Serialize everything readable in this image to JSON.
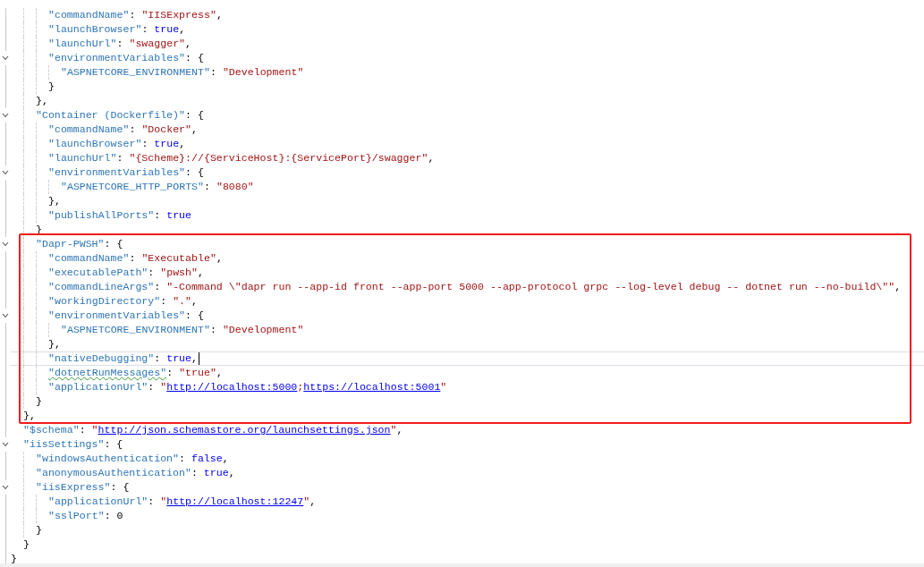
{
  "editor": {
    "root": {
      "children": [
        {
          "children": [
            {
              "children": [
                {
                  "line": [
                    {
                      "kind": "key",
                      "text": "\"commandName\""
                    },
                    {
                      "kind": "p",
                      "text": ": "
                    },
                    {
                      "kind": "str",
                      "text": "\"IISExpress\""
                    },
                    {
                      "kind": "p",
                      "text": ","
                    }
                  ]
                },
                {
                  "line": [
                    {
                      "kind": "key",
                      "text": "\"launchBrowser\""
                    },
                    {
                      "kind": "p",
                      "text": ": "
                    },
                    {
                      "kind": "kw",
                      "text": "true"
                    },
                    {
                      "kind": "p",
                      "text": ","
                    }
                  ]
                },
                {
                  "line": [
                    {
                      "kind": "key",
                      "text": "\"launchUrl\""
                    },
                    {
                      "kind": "p",
                      "text": ": "
                    },
                    {
                      "kind": "str",
                      "text": "\"swagger\""
                    },
                    {
                      "kind": "p",
                      "text": ","
                    }
                  ]
                },
                {
                  "line": [
                    {
                      "kind": "key",
                      "text": "\"environmentVariables\""
                    },
                    {
                      "kind": "p",
                      "text": ": {"
                    }
                  ],
                  "children": [
                    {
                      "line": [
                        {
                          "kind": "key",
                          "text": "\"ASPNETCORE_ENVIRONMENT\""
                        },
                        {
                          "kind": "p",
                          "text": ": "
                        },
                        {
                          "kind": "str",
                          "text": "\"Development\""
                        }
                      ]
                    }
                  ],
                  "close": [
                    {
                      "kind": "p",
                      "text": "}"
                    }
                  ]
                }
              ],
              "close": [
                {
                  "kind": "p",
                  "text": "},"
                }
              ]
            },
            {
              "line": [
                {
                  "kind": "key",
                  "text": "\"Container (Dockerfile)\""
                },
                {
                  "kind": "p",
                  "text": ": {"
                }
              ],
              "children": [
                {
                  "line": [
                    {
                      "kind": "key",
                      "text": "\"commandName\""
                    },
                    {
                      "kind": "p",
                      "text": ": "
                    },
                    {
                      "kind": "str",
                      "text": "\"Docker\""
                    },
                    {
                      "kind": "p",
                      "text": ","
                    }
                  ]
                },
                {
                  "line": [
                    {
                      "kind": "key",
                      "text": "\"launchBrowser\""
                    },
                    {
                      "kind": "p",
                      "text": ": "
                    },
                    {
                      "kind": "kw",
                      "text": "true"
                    },
                    {
                      "kind": "p",
                      "text": ","
                    }
                  ]
                },
                {
                  "line": [
                    {
                      "kind": "key",
                      "text": "\"launchUrl\""
                    },
                    {
                      "kind": "p",
                      "text": ": "
                    },
                    {
                      "kind": "str",
                      "text": "\"{Scheme}://{ServiceHost}:{ServicePort}/swagger\""
                    },
                    {
                      "kind": "p",
                      "text": ","
                    }
                  ]
                },
                {
                  "line": [
                    {
                      "kind": "key",
                      "text": "\"environmentVariables\""
                    },
                    {
                      "kind": "p",
                      "text": ": {"
                    }
                  ],
                  "children": [
                    {
                      "line": [
                        {
                          "kind": "key",
                          "text": "\"ASPNETCORE_HTTP_PORTS\""
                        },
                        {
                          "kind": "p",
                          "text": ": "
                        },
                        {
                          "kind": "str",
                          "text": "\"8080\""
                        }
                      ]
                    }
                  ],
                  "close": [
                    {
                      "kind": "p",
                      "text": "},"
                    }
                  ]
                },
                {
                  "line": [
                    {
                      "kind": "key",
                      "text": "\"publishAllPorts\""
                    },
                    {
                      "kind": "p",
                      "text": ": "
                    },
                    {
                      "kind": "kw",
                      "text": "true"
                    }
                  ]
                }
              ],
              "close": [
                {
                  "kind": "p",
                  "text": "}"
                }
              ]
            },
            {
              "boxed": true,
              "line": [
                {
                  "kind": "key",
                  "text": "\"Dapr-PWSH\""
                },
                {
                  "kind": "p",
                  "text": ": {"
                }
              ],
              "children": [
                {
                  "line": [
                    {
                      "kind": "key",
                      "text": "\"commandName\""
                    },
                    {
                      "kind": "p",
                      "text": ": "
                    },
                    {
                      "kind": "str",
                      "text": "\"Executable\""
                    },
                    {
                      "kind": "p",
                      "text": ","
                    }
                  ]
                },
                {
                  "line": [
                    {
                      "kind": "key",
                      "text": "\"executablePath\""
                    },
                    {
                      "kind": "p",
                      "text": ": "
                    },
                    {
                      "kind": "str",
                      "text": "\"pwsh\""
                    },
                    {
                      "kind": "p",
                      "text": ","
                    }
                  ]
                },
                {
                  "line": [
                    {
                      "kind": "key",
                      "text": "\"commandLineArgs\""
                    },
                    {
                      "kind": "p",
                      "text": ": "
                    },
                    {
                      "kind": "str",
                      "text": "\"-Command \\\"dapr run --app-id front --app-port 5000 --app-protocol grpc --log-level debug -- dotnet run --no-build\\\"\""
                    },
                    {
                      "kind": "p",
                      "text": ","
                    }
                  ]
                },
                {
                  "line": [
                    {
                      "kind": "key",
                      "text": "\"workingDirectory\""
                    },
                    {
                      "kind": "p",
                      "text": ": "
                    },
                    {
                      "kind": "str",
                      "text": "\".\""
                    },
                    {
                      "kind": "p",
                      "text": ","
                    }
                  ]
                },
                {
                  "line": [
                    {
                      "kind": "key",
                      "text": "\"environmentVariables\""
                    },
                    {
                      "kind": "p",
                      "text": ": {"
                    }
                  ],
                  "children": [
                    {
                      "line": [
                        {
                          "kind": "key",
                          "text": "\"ASPNETCORE_ENVIRONMENT\""
                        },
                        {
                          "kind": "p",
                          "text": ": "
                        },
                        {
                          "kind": "str",
                          "text": "\"Development\""
                        }
                      ]
                    }
                  ],
                  "close": [
                    {
                      "kind": "p",
                      "text": "},"
                    }
                  ]
                },
                {
                  "current": true,
                  "line": [
                    {
                      "kind": "key",
                      "text": "\"nativeDebugging\""
                    },
                    {
                      "kind": "p",
                      "text": ": "
                    },
                    {
                      "kind": "kw",
                      "text": "true"
                    },
                    {
                      "kind": "p",
                      "text": ","
                    }
                  ]
                },
                {
                  "line": [
                    {
                      "kind": "key-warning",
                      "text": "\"dotnetRunMessages\""
                    },
                    {
                      "kind": "p",
                      "text": ": "
                    },
                    {
                      "kind": "str",
                      "text": "\"true\""
                    },
                    {
                      "kind": "p",
                      "text": ","
                    }
                  ]
                },
                {
                  "line": [
                    {
                      "kind": "key",
                      "text": "\"applicationUrl\""
                    },
                    {
                      "kind": "p",
                      "text": ": "
                    },
                    {
                      "kind": "str",
                      "text": "\""
                    },
                    {
                      "kind": "link",
                      "text": "http://localhost:5000"
                    },
                    {
                      "kind": "str",
                      "text": ";"
                    },
                    {
                      "kind": "link",
                      "text": "https://localhost:5001"
                    },
                    {
                      "kind": "str",
                      "text": "\""
                    }
                  ]
                }
              ],
              "close": [
                {
                  "kind": "p",
                  "text": "}"
                }
              ]
            }
          ],
          "close": [
            {
              "kind": "p",
              "text": "},"
            }
          ]
        },
        {
          "line": [
            {
              "kind": "key",
              "text": "\"$schema\""
            },
            {
              "kind": "p",
              "text": ": "
            },
            {
              "kind": "str",
              "text": "\""
            },
            {
              "kind": "link",
              "text": "http://json.schemastore.org/launchsettings.json"
            },
            {
              "kind": "str",
              "text": "\""
            },
            {
              "kind": "p",
              "text": ","
            }
          ]
        },
        {
          "line": [
            {
              "kind": "key",
              "text": "\"iisSettings\""
            },
            {
              "kind": "p",
              "text": ": {"
            }
          ],
          "children": [
            {
              "line": [
                {
                  "kind": "key",
                  "text": "\"windowsAuthentication\""
                },
                {
                  "kind": "p",
                  "text": ": "
                },
                {
                  "kind": "kw",
                  "text": "false"
                },
                {
                  "kind": "p",
                  "text": ","
                }
              ]
            },
            {
              "line": [
                {
                  "kind": "key",
                  "text": "\"anonymousAuthentication\""
                },
                {
                  "kind": "p",
                  "text": ": "
                },
                {
                  "kind": "kw",
                  "text": "true"
                },
                {
                  "kind": "p",
                  "text": ","
                }
              ]
            },
            {
              "line": [
                {
                  "kind": "key",
                  "text": "\"iisExpress\""
                },
                {
                  "kind": "p",
                  "text": ": {"
                }
              ],
              "children": [
                {
                  "line": [
                    {
                      "kind": "key",
                      "text": "\"applicationUrl\""
                    },
                    {
                      "kind": "p",
                      "text": ": "
                    },
                    {
                      "kind": "str",
                      "text": "\""
                    },
                    {
                      "kind": "link",
                      "text": "http://localhost:12247"
                    },
                    {
                      "kind": "str",
                      "text": "\""
                    },
                    {
                      "kind": "p",
                      "text": ","
                    }
                  ]
                },
                {
                  "line": [
                    {
                      "kind": "key",
                      "text": "\"sslPort\""
                    },
                    {
                      "kind": "p",
                      "text": ": "
                    },
                    {
                      "kind": "num",
                      "text": "0"
                    }
                  ]
                }
              ],
              "close": [
                {
                  "kind": "p",
                  "text": "}"
                }
              ]
            }
          ],
          "close": [
            {
              "kind": "p",
              "text": "}"
            }
          ]
        }
      ],
      "close": [
        {
          "kind": "p",
          "text": "}"
        }
      ]
    }
  }
}
